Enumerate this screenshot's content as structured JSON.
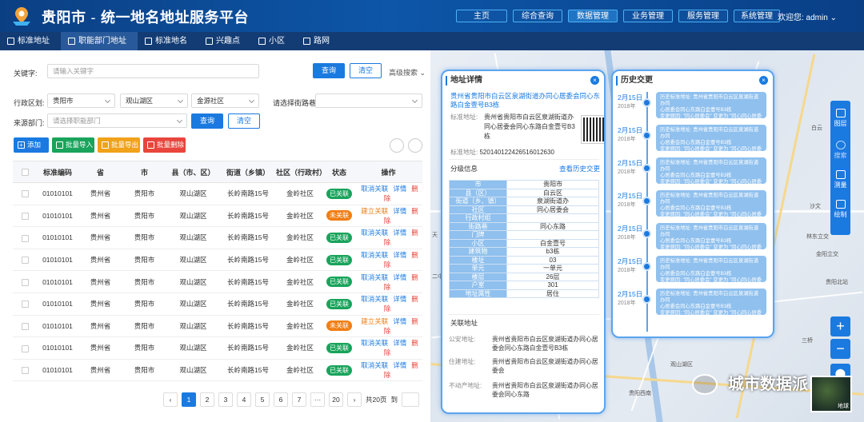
{
  "app": {
    "title": "贵阳市",
    "subtitle": "统一地名地址服务平台",
    "sep": "-"
  },
  "topnav": [
    {
      "label": "主页",
      "w": 58
    },
    {
      "label": "综合查询",
      "w": 58
    },
    {
      "label": "数据管理",
      "w": 58,
      "active": true
    },
    {
      "label": "业务管理",
      "w": 58
    },
    {
      "label": "服务管理",
      "w": 58
    },
    {
      "label": "系统管理",
      "w": 58
    }
  ],
  "welcome": "欢迎您: admin",
  "tabs": [
    "标准地址",
    "职能部门地址",
    "标准地名",
    "兴趣点",
    "小区",
    "路网"
  ],
  "search": {
    "keyword_label": "关键字:",
    "keyword_placeholder": "请输入关键字",
    "query": "查询",
    "clear": "清空",
    "advanced": "高级搜索",
    "region_label": "行政区划:",
    "region": [
      "贵阳市",
      "观山湖区",
      "金源社区"
    ],
    "street_label": "请选择街路巷:",
    "dept_label": "来源部门:",
    "dept_placeholder": "请选择职能部门",
    "query2": "查询",
    "clear2": "清空"
  },
  "actions": {
    "add": "添加",
    "import": "批量导入",
    "export": "批量导出",
    "delete": "批量删除"
  },
  "table": {
    "headers": [
      "",
      "标准编码",
      "省",
      "市",
      "县（市、区）",
      "街道（乡镇）",
      "社区（行政村）",
      "状态",
      "操作"
    ],
    "rows": [
      {
        "code": "01010101",
        "prov": "贵州省",
        "city": "贵阳市",
        "county": "观山湖区",
        "street": "长岭南路15号",
        "comm": "金岭社区",
        "status": "已关联",
        "linked": true,
        "op1": "取消关联",
        "op2": "详情",
        "op3": "删除"
      },
      {
        "code": "01010101",
        "prov": "贵州省",
        "city": "贵阳市",
        "county": "观山湖区",
        "street": "长岭南路15号",
        "comm": "金岭社区",
        "status": "未关联",
        "linked": false,
        "op1": "建立关联",
        "op2": "详情",
        "op3": "删除"
      },
      {
        "code": "01010101",
        "prov": "贵州省",
        "city": "贵阳市",
        "county": "观山湖区",
        "street": "长岭南路15号",
        "comm": "金岭社区",
        "status": "已关联",
        "linked": true,
        "op1": "取消关联",
        "op2": "详情",
        "op3": "删除"
      },
      {
        "code": "01010101",
        "prov": "贵州省",
        "city": "贵阳市",
        "county": "观山湖区",
        "street": "长岭南路15号",
        "comm": "金岭社区",
        "status": "已关联",
        "linked": true,
        "op1": "取消关联",
        "op2": "详情",
        "op3": "删除"
      },
      {
        "code": "01010101",
        "prov": "贵州省",
        "city": "贵阳市",
        "county": "观山湖区",
        "street": "长岭南路15号",
        "comm": "金岭社区",
        "status": "已关联",
        "linked": true,
        "op1": "取消关联",
        "op2": "详情",
        "op3": "删除"
      },
      {
        "code": "01010101",
        "prov": "贵州省",
        "city": "贵阳市",
        "county": "观山湖区",
        "street": "长岭南路15号",
        "comm": "金岭社区",
        "status": "已关联",
        "linked": true,
        "op1": "取消关联",
        "op2": "详情",
        "op3": "删除"
      },
      {
        "code": "01010101",
        "prov": "贵州省",
        "city": "贵阳市",
        "county": "观山湖区",
        "street": "长岭南路15号",
        "comm": "金岭社区",
        "status": "未关联",
        "linked": false,
        "op1": "建立关联",
        "op2": "详情",
        "op3": "删除"
      },
      {
        "code": "01010101",
        "prov": "贵州省",
        "city": "贵阳市",
        "county": "观山湖区",
        "street": "长岭南路15号",
        "comm": "金岭社区",
        "status": "已关联",
        "linked": true,
        "op1": "取消关联",
        "op2": "详情",
        "op3": "删除"
      },
      {
        "code": "01010101",
        "prov": "贵州省",
        "city": "贵阳市",
        "county": "观山湖区",
        "street": "长岭南路15号",
        "comm": "金岭社区",
        "status": "已关联",
        "linked": true,
        "op1": "取消关联",
        "op2": "详情",
        "op3": "删除"
      }
    ]
  },
  "pager": {
    "prev": "‹",
    "pages": [
      "1",
      "2",
      "3",
      "4",
      "5",
      "6",
      "7",
      "···",
      "20"
    ],
    "next": "›",
    "total": "共20页",
    "goto": "到"
  },
  "detail": {
    "title": "地址详情",
    "full": "贵州省贵阳市白云区泉湖街道办同心居委会同心东路白金壹号B3栋",
    "std_label": "标准地址:",
    "std_value": "贵州省贵阳市白云区泉湖街道办同心居委会同心东路白金壹号B3栋",
    "code_label": "标准地址:",
    "code_value": "520140122426516012630",
    "level_title": "分级信息",
    "history_link": "查看历史交更",
    "levels": [
      [
        "市",
        "贵阳市"
      ],
      [
        "县（区）",
        "白云区"
      ],
      [
        "街道（乡、镇）",
        "泉湖街道办"
      ],
      [
        "社区",
        "同心居委会"
      ],
      [
        "行政村组",
        ""
      ],
      [
        "街路巷",
        "同心东路"
      ],
      [
        "门牌",
        ""
      ],
      [
        "小区",
        "白金壹号"
      ],
      [
        "建筑物",
        "b3栋"
      ],
      [
        "楼址",
        "03"
      ],
      [
        "单元",
        "一单元"
      ],
      [
        "楼层",
        "26层"
      ],
      [
        "户室",
        "301"
      ],
      [
        "地址属性",
        "居住"
      ]
    ],
    "rel_title": "关联地址",
    "rel": [
      {
        "k": "公安地址:",
        "v": "贵州省贵阳市白云区泉湖街道办同心居委会同心东路白金壹号B3栋"
      },
      {
        "k": "住建地址:",
        "v": "贵州省贵阳市白云区泉湖街道办同心居委会"
      },
      {
        "k": "不动产地址:",
        "v": "贵州省贵阳市白云区泉湖街道办同心居委会同心东路"
      }
    ]
  },
  "history": {
    "title": "历史交更",
    "items": [
      {
        "date": "2月15日",
        "year": "2018年",
        "line1": "历史标准地址: 贵州省贵阳市白云区泉湖街道办同",
        "line2": "心居委会同心东路白金壹号B3栋",
        "line3": "变更原因: \"同心居委会\" 变更为 \"同心同心居委会\""
      },
      {
        "date": "2月15日",
        "year": "2018年",
        "line1": "历史标准地址: 贵州省贵阳市白云区泉湖街道办同",
        "line2": "心居委会同心东路白金壹号B3栋",
        "line3": "变更原因: \"同心居委会\" 变更为 \"同心同心居委会\""
      },
      {
        "date": "2月15日",
        "year": "2018年",
        "line1": "历史标准地址: 贵州省贵阳市白云区泉湖街道办同",
        "line2": "心居委会同心东路白金壹号B3栋",
        "line3": "变更原因: \"同心居委会\" 变更为 \"同心同心居委会\""
      },
      {
        "date": "2月15日",
        "year": "2018年",
        "line1": "历史标准地址: 贵州省贵阳市白云区泉湖街道办同",
        "line2": "心居委会同心东路白金壹号B3栋",
        "line3": "变更原因: \"同心居委会\" 变更为 \"同心同心居委会\""
      },
      {
        "date": "2月15日",
        "year": "2018年",
        "line1": "历史标准地址: 贵州省贵阳市白云区泉湖街道办同",
        "line2": "心居委会同心东路白金壹号B3栋",
        "line3": "变更原因: \"同心居委会\" 变更为 \"同心同心居委会\""
      },
      {
        "date": "2月15日",
        "year": "2018年",
        "line1": "历史标准地址: 贵州省贵阳市白云区泉湖街道办同",
        "line2": "心居委会同心东路白金壹号B3栋",
        "line3": "变更原因: \"同心居委会\" 变更为 \"同心同心居委会\""
      },
      {
        "date": "2月15日",
        "year": "2018年",
        "line1": "历史标准地址: 贵州省贵阳市白云区泉湖街道办同",
        "line2": "心居委会同心东路白金壹号B3栋",
        "line3": "变更原因: \"同心居委会\" 变更为 \"同心同心居委会\""
      }
    ]
  },
  "maptools": [
    "图层",
    "搜索",
    "测量",
    "绘制"
  ],
  "zoom": {
    "in": "+",
    "out": "−"
  },
  "maplabels": [
    "白云",
    "沙文",
    "林东立交",
    "金阳立交",
    "贵阳北站",
    "三桥",
    "观山湖区",
    "贵阳西南",
    "天",
    "二中"
  ],
  "watermark": "城市数据派",
  "thumb_label": "地球"
}
